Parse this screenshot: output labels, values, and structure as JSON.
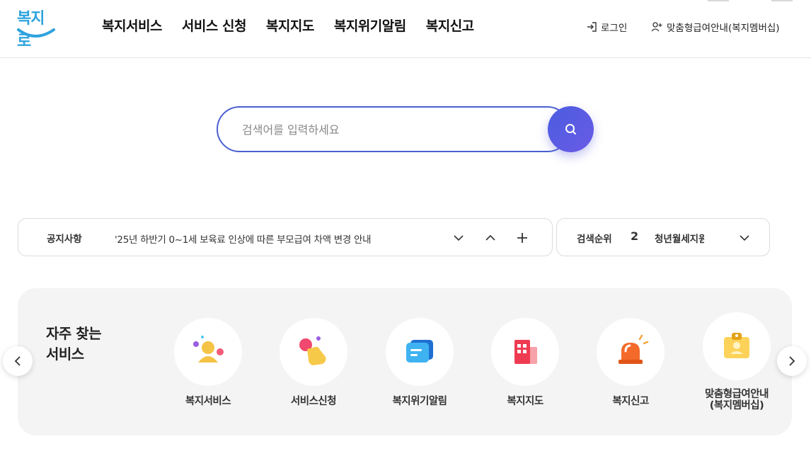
{
  "header": {
    "logo_text": "복지로",
    "nav": [
      "복지서비스",
      "서비스 신청",
      "복지지도",
      "복지위기알림",
      "복지신고"
    ],
    "login_label": "로그인",
    "member_label": "맞춤형급여안내(복지멤버십)"
  },
  "search": {
    "placeholder": "검색어를 입력하세요",
    "button_icon": "search-icon"
  },
  "notice": {
    "label": "공지사항",
    "text": "'25년 하반기 0~1세 보육료 인상에 따른 부모급여 차액 변경 안내",
    "controls": [
      "chevron-down-icon",
      "chevron-up-icon",
      "plus-icon"
    ]
  },
  "ranking": {
    "label": "검색순위",
    "number": "2",
    "text": "청년월세지원",
    "control": "chevron-down-icon"
  },
  "services": {
    "title_line1": "자주 찾는",
    "title_line2": "서비스",
    "items": [
      {
        "label": "복지서비스",
        "icon": "person-icon"
      },
      {
        "label": "서비스신청",
        "icon": "hand-tap-icon"
      },
      {
        "label": "복지위기알림",
        "icon": "message-icon"
      },
      {
        "label": "복지지도",
        "icon": "building-icon"
      },
      {
        "label": "복지신고",
        "icon": "siren-icon"
      },
      {
        "label_line1": "맞춤형급여안내",
        "label_line2": "(복지멤버십)",
        "icon": "id-card-icon"
      }
    ],
    "prev_icon": "chevron-left-icon",
    "next_icon": "chevron-right-icon"
  },
  "colors": {
    "brand_blue": "#2ea3dd",
    "search_border": "#4a5fd1",
    "search_button": "#5b5ce3",
    "panel_bg": "#f4f4f4"
  }
}
